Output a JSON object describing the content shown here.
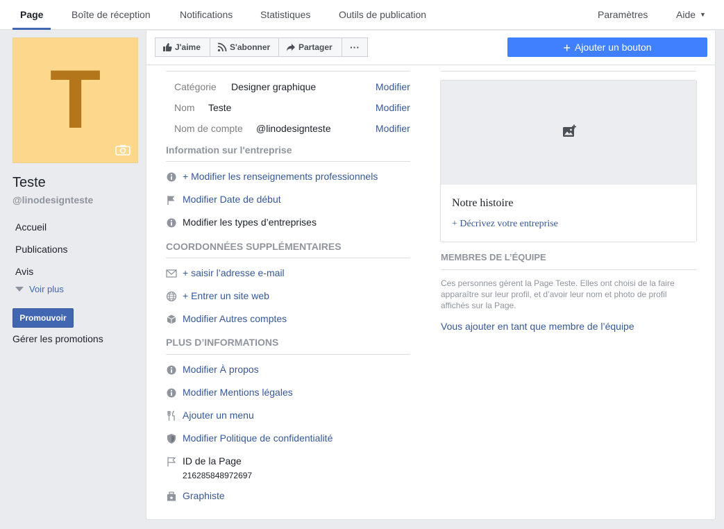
{
  "topnav": {
    "tabs": [
      "Page",
      "Boîte de réception",
      "Notifications",
      "Statistiques",
      "Outils de publication"
    ],
    "settings": "Paramètres",
    "help": "Aide"
  },
  "sidebar": {
    "avatar_letter": "T",
    "page_name": "Teste",
    "page_handle": "@linodesignteste",
    "links": [
      "Accueil",
      "Publications",
      "Avis"
    ],
    "see_more": "Voir plus",
    "promote": "Promouvoir",
    "manage_promotions": "Gérer les promotions"
  },
  "actionbar": {
    "like": "J'aime",
    "follow": "S'abonner",
    "share": "Partager",
    "more": "···",
    "add_button": "Ajouter un bouton"
  },
  "info": {
    "rows": [
      {
        "label": "Catégorie",
        "value": "Designer graphique",
        "action": "Modifier"
      },
      {
        "label": "Nom",
        "value": "Teste",
        "action": "Modifier"
      },
      {
        "label": "Nom de compte",
        "value": "@linodesignteste",
        "action": "Modifier"
      }
    ],
    "business_title": "Information sur l'entreprise",
    "business_items": [
      {
        "icon": "info-icon",
        "text": "+ Modifier les renseignements professionnels"
      },
      {
        "icon": "flag-icon",
        "text": "Modifier Date de début"
      },
      {
        "icon": "info-icon",
        "text": "Modifier les types d’entreprises"
      }
    ],
    "contact_title": "COORDONNÉES SUPPLÉMENTAIRES",
    "contact_items": [
      {
        "icon": "envelope-icon",
        "text": "+ saisir l’adresse e-mail"
      },
      {
        "icon": "globe-icon",
        "text": "+ Entrer un site web"
      },
      {
        "icon": "cube-icon",
        "text": "Modifier Autres comptes"
      }
    ],
    "more_title": "PLUS D’INFORMATIONS",
    "more_items": [
      {
        "icon": "info-icon",
        "text": "Modifier À propos"
      },
      {
        "icon": "info-icon",
        "text": "Modifier Mentions légales"
      },
      {
        "icon": "fork-knife-icon",
        "text": "Ajouter un menu"
      },
      {
        "icon": "shield-icon",
        "text": "Modifier Politique de confidentialité"
      }
    ],
    "page_id_label": "ID de la Page",
    "page_id": "216285848972697",
    "category_link": "Graphiste"
  },
  "story": {
    "title": "Notre histoire",
    "link": "+ Décrivez votre entreprise"
  },
  "team": {
    "title": "MEMBRES DE L’ÉQUIPE",
    "description": "Ces personnes gèrent la Page Teste. Elles ont choisi de la faire apparaître sur leur profil, et d’avoir leur nom et photo de profil affichés sur la Page.",
    "link": "Vous ajouter en tant que membre de l’équipe"
  },
  "colors": {
    "primary": "#4267b2",
    "add_button": "#4080ff",
    "link": "#365899",
    "avatar_bg": "#fdd88c",
    "avatar_letter": "#b4761b"
  }
}
